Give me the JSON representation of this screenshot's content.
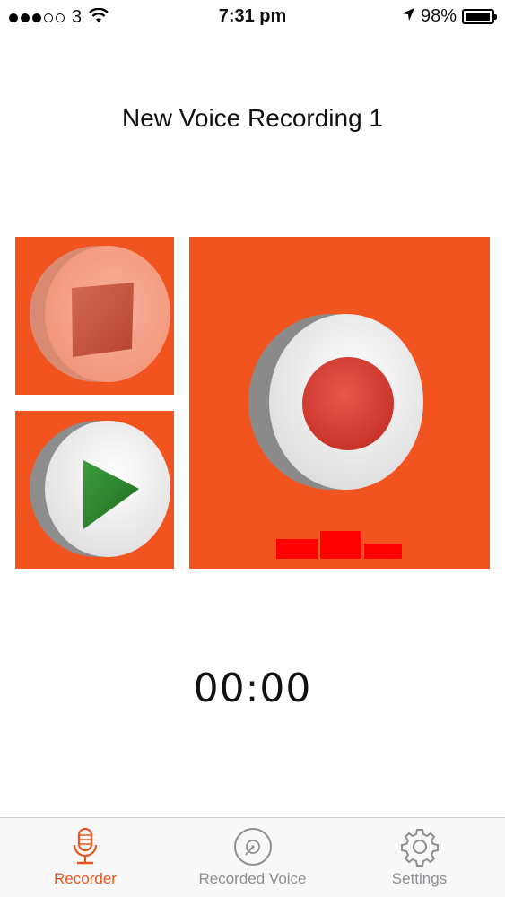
{
  "status_bar": {
    "signal_dots_filled": 3,
    "signal_dots_total": 5,
    "carrier": "3",
    "time": "7:31 pm",
    "battery_percent": "98%",
    "battery_level": 0.98
  },
  "page": {
    "title": "New Voice Recording 1"
  },
  "controls": {
    "stop": {
      "icon": "stop-icon"
    },
    "play": {
      "icon": "play-icon"
    },
    "record": {
      "icon": "record-icon",
      "level_meter_icon": "level-meter-icon"
    }
  },
  "timer": "00:00",
  "tab_bar": {
    "items": [
      {
        "label": "Recorder",
        "icon": "microphone-icon",
        "active": true
      },
      {
        "label": "Recorded Voice",
        "icon": "disc-icon",
        "active": false
      },
      {
        "label": "Settings",
        "icon": "gear-icon",
        "active": false
      }
    ]
  },
  "colors": {
    "tile_bg": "#f25420",
    "accent": "#e8551c",
    "play_green": "#2e8b2e",
    "record_red": "#d93a2a",
    "level_red": "#ff0000",
    "inactive_tab": "#8e8e93"
  }
}
